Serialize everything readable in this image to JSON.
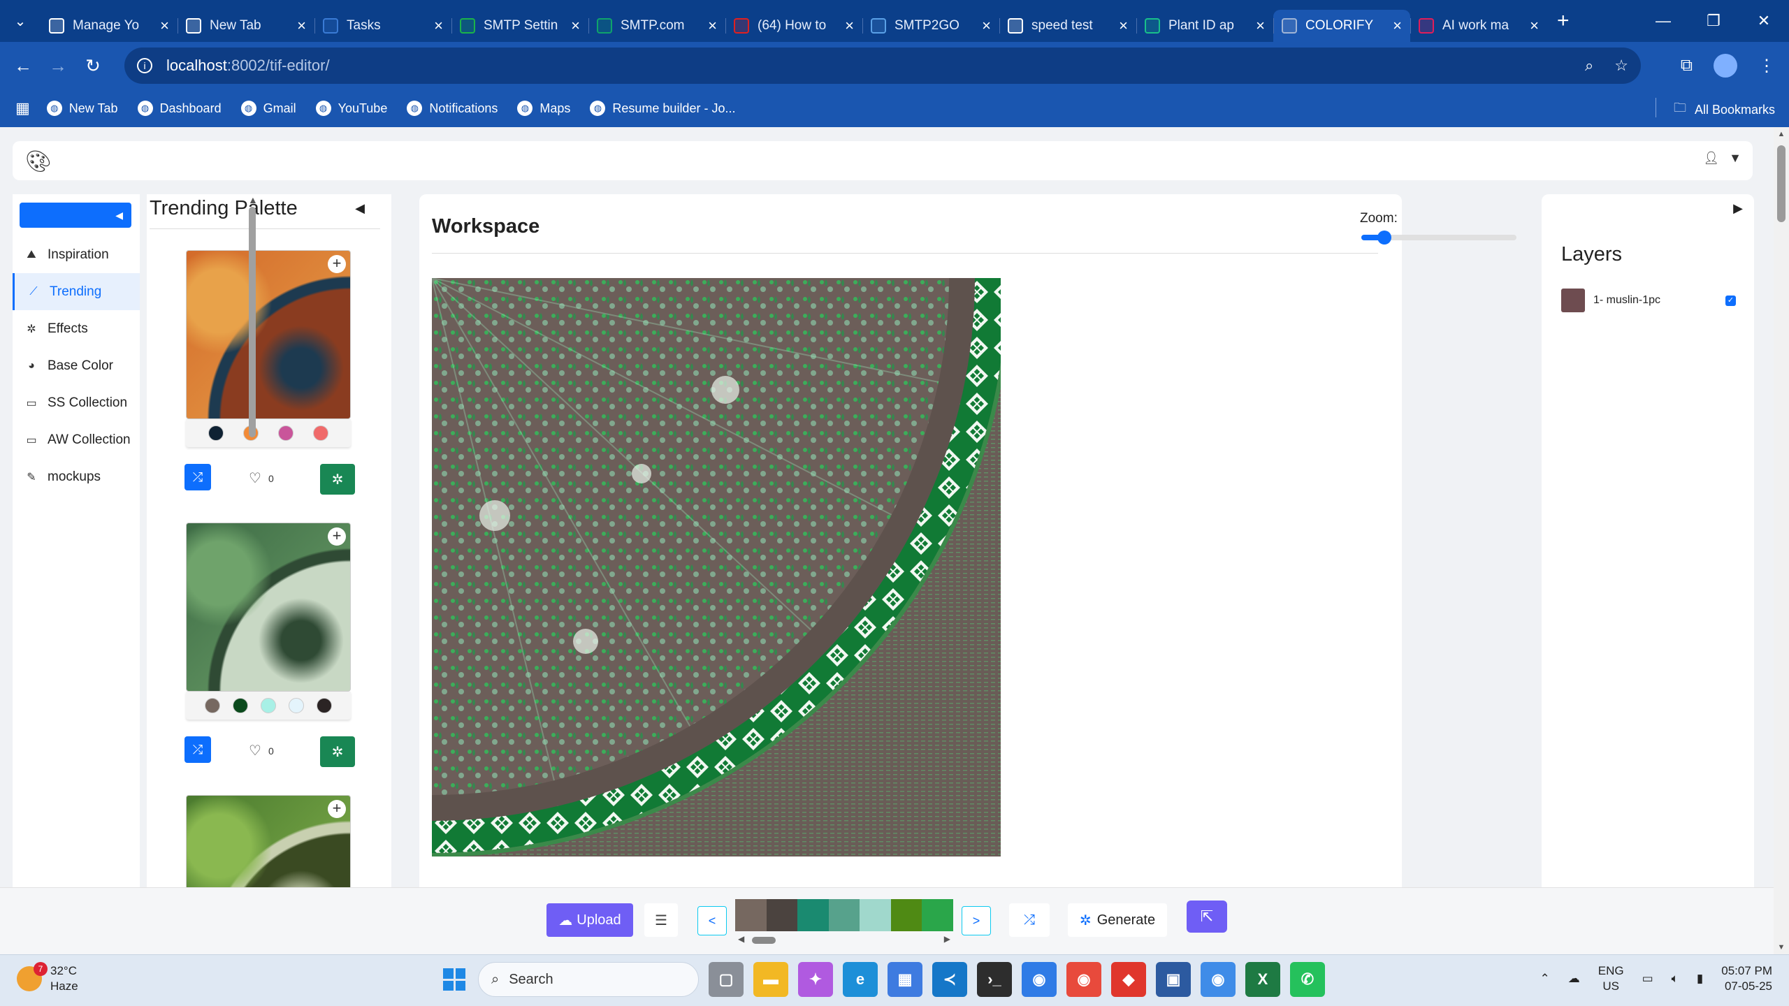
{
  "browser": {
    "tabs": [
      {
        "title": "Manage Yo",
        "icon": "document-icon",
        "color": "#ffffff"
      },
      {
        "title": "New Tab",
        "icon": "chrome-icon",
        "color": "#ffffff"
      },
      {
        "title": "Tasks",
        "icon": "tasks-icon",
        "color": "#3a7bd5"
      },
      {
        "title": "SMTP Settin",
        "icon": "check-logo-icon",
        "color": "#1bb34a"
      },
      {
        "title": "SMTP.com",
        "icon": "smtp-logo-icon",
        "color": "#0fa36b"
      },
      {
        "title": "(64) How to",
        "icon": "youtube-icon",
        "color": "#e02020"
      },
      {
        "title": "SMTP2GO",
        "icon": "mail-icon",
        "color": "#5aa0e6"
      },
      {
        "title": "speed test",
        "icon": "google-icon",
        "color": "#ffffff"
      },
      {
        "title": "Plant ID ap",
        "icon": "plant-logo-icon",
        "color": "#19c08a"
      },
      {
        "title": "COLORIFY",
        "icon": "globe-icon",
        "color": "#9fb4d6"
      },
      {
        "title": "AI work ma",
        "icon": "slack-icon",
        "color": "#e01e5a"
      }
    ],
    "active_tab": "COLORIFY",
    "url_host": "localhost",
    "url_path": ":8002/tif-editor/",
    "bookmarks": [
      {
        "label": "New Tab",
        "icon": "globe-icon"
      },
      {
        "label": "Dashboard",
        "icon": "globe-icon"
      },
      {
        "label": "Gmail",
        "icon": "gmail-icon"
      },
      {
        "label": "YouTube",
        "icon": "youtube-icon"
      },
      {
        "label": "Notifications",
        "icon": "globe-icon"
      },
      {
        "label": "Maps",
        "icon": "maps-icon"
      },
      {
        "label": "Resume builder - Jo...",
        "icon": "resume-icon"
      }
    ],
    "all_bookmarks": "All Bookmarks"
  },
  "sidebar": {
    "items": [
      {
        "label": "Inspiration",
        "icon": "landscape-icon"
      },
      {
        "label": "Trending",
        "icon": "chart-line-icon"
      },
      {
        "label": "Effects",
        "icon": "sparkle-icon"
      },
      {
        "label": "Base Color",
        "icon": "palette-icon"
      },
      {
        "label": "SS Collection",
        "icon": "folder-icon"
      },
      {
        "label": "AW Collection",
        "icon": "folder-icon"
      },
      {
        "label": "mockups",
        "icon": "pencil-icon"
      }
    ],
    "active": "Trending"
  },
  "trending": {
    "title": "Trending Palette",
    "cards": [
      {
        "swatches": [
          "#0f2233",
          "#f28a36",
          "#c9559a",
          "#f06a6a"
        ],
        "likes": "0",
        "image_tones": [
          "#d36a2a",
          "#e8a24a",
          "#8a3c20",
          "#1d3a50"
        ]
      },
      {
        "swatches": [
          "#766860",
          "#0b4a1c",
          "#a8f0e6",
          "#e4f4fc",
          "#2b2424"
        ],
        "likes": "0",
        "image_tones": [
          "#3d6b45",
          "#6fa36b",
          "#c8d8c4",
          "#2f4a34"
        ]
      },
      {
        "swatches": [],
        "likes": "",
        "image_tones": [
          "#4a7a2e",
          "#8ab850",
          "#3a4a22",
          "#c8d0b0"
        ]
      }
    ]
  },
  "workspace": {
    "title": "Workspace",
    "zoom_label": "Zoom:",
    "zoom_level": 0.15
  },
  "layers": {
    "title": "Layers",
    "items": [
      {
        "name": "1- muslin-1pc",
        "checked": true
      }
    ]
  },
  "bottom": {
    "upload_label": "Upload",
    "prev_label": "<",
    "next_label": ">",
    "generate_label": "Generate",
    "palette": [
      "#766860",
      "#4b433f",
      "#1a8a70",
      "#57a28c",
      "#a0d8cc",
      "#4f8a14",
      "#2aa64a"
    ]
  },
  "taskbar": {
    "temperature": "32°C",
    "condition": "Haze",
    "weather_badge": "7",
    "search_placeholder": "Search",
    "lang_top": "ENG",
    "lang_bottom": "US",
    "time": "05:07 PM",
    "date": "07-05-25"
  }
}
